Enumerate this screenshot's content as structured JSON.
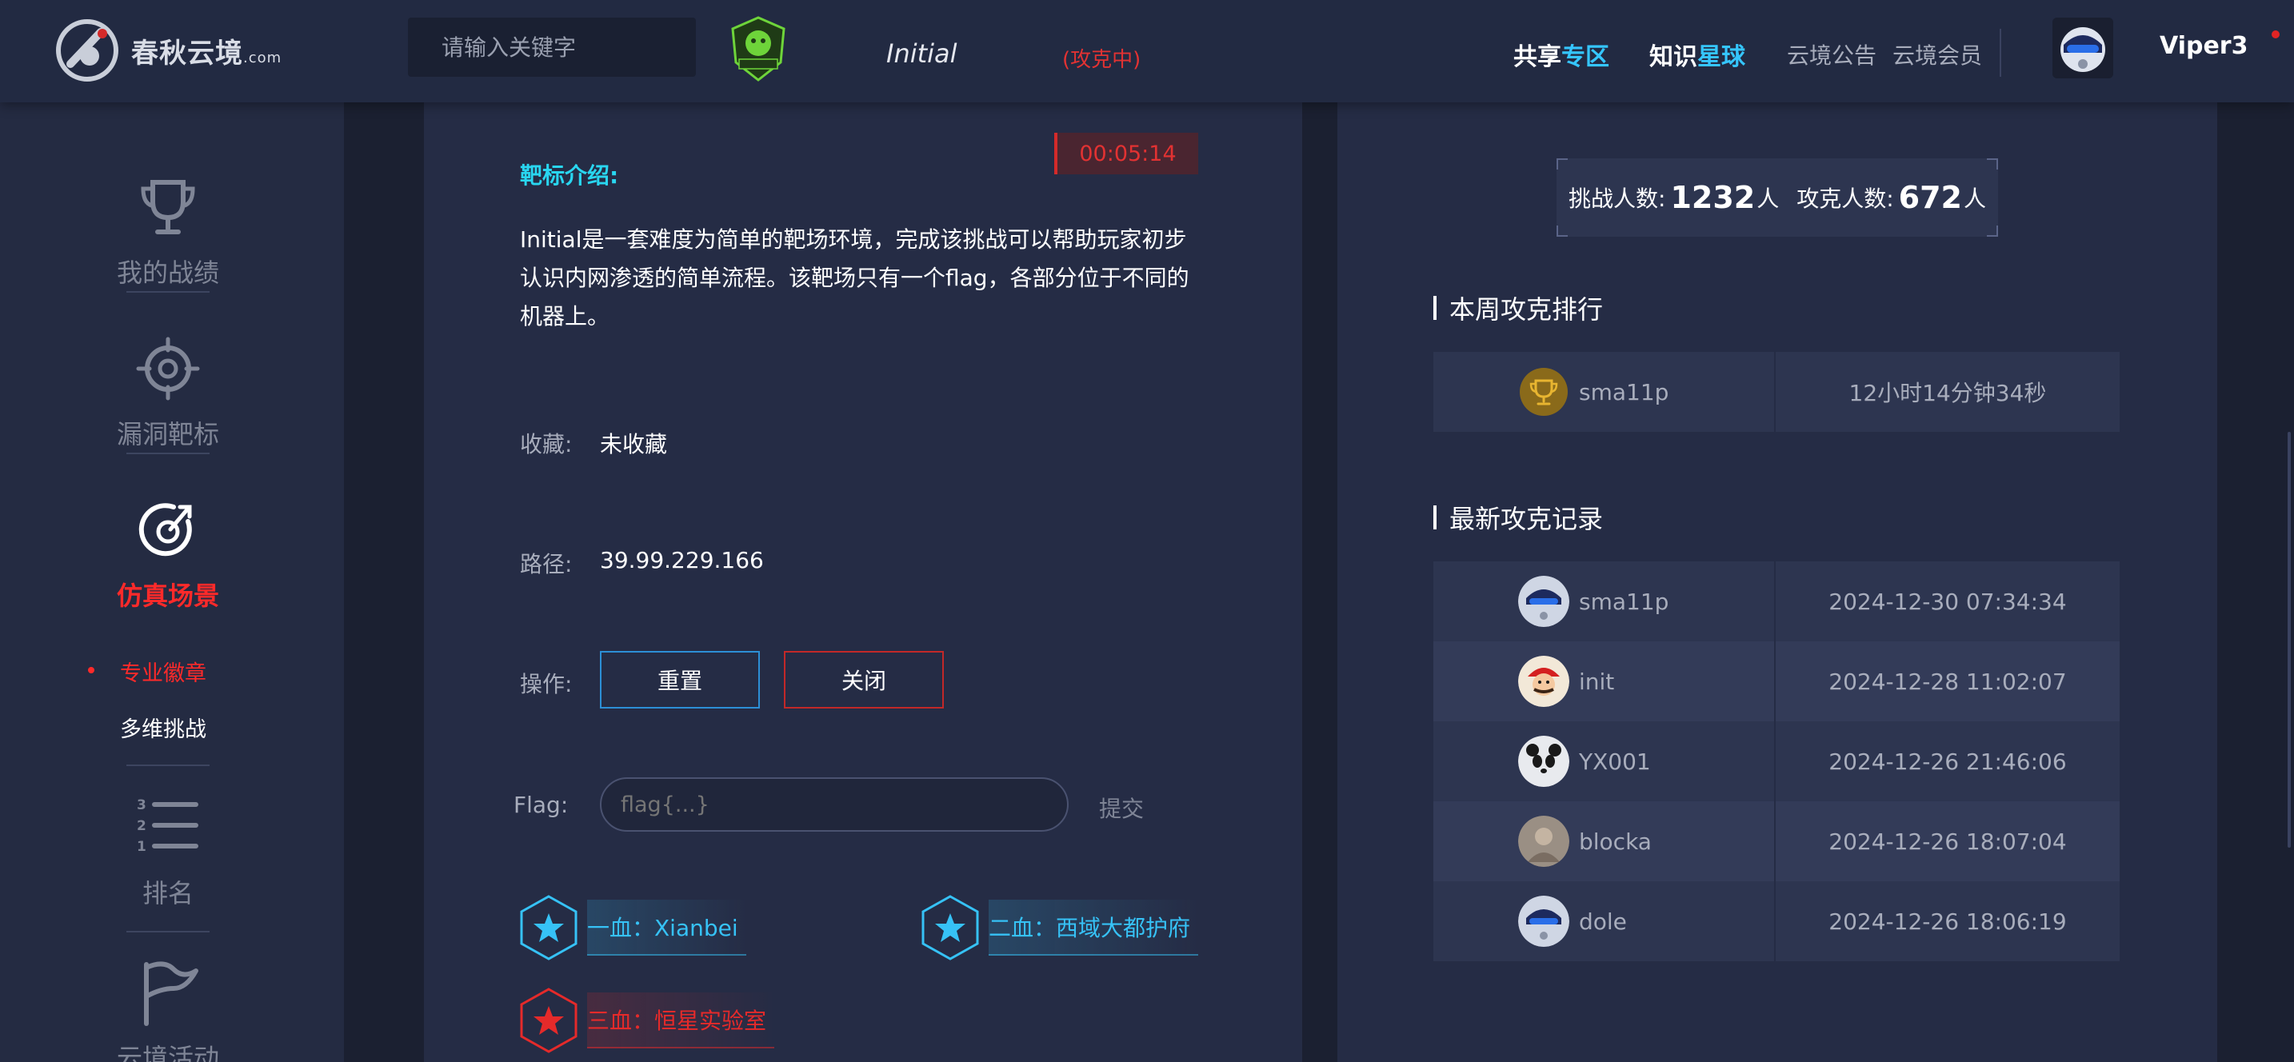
{
  "header": {
    "logo_text": "春秋云境",
    "logo_suffix": ".com",
    "search_placeholder": "请输入关键字",
    "target_name": "Initial",
    "target_status": "(攻克中)",
    "nav_share_a": "共享",
    "nav_share_b": "专区",
    "nav_planet_a": "知识",
    "nav_planet_b": "星球",
    "nav_notice": "云境公告",
    "nav_member": "云境会员",
    "username": "Viper3"
  },
  "sidebar": {
    "items": [
      {
        "label": "我的战绩",
        "icon": "trophy-icon"
      },
      {
        "label": "漏洞靶标",
        "icon": "crosshair-icon"
      },
      {
        "label": "仿真场景",
        "icon": "refresh-target-icon"
      },
      {
        "label": "排名",
        "icon": "ranking-list-icon"
      },
      {
        "label": "云境活动",
        "icon": "flag-icon"
      }
    ],
    "sub_items": [
      {
        "label": "专业徽章"
      },
      {
        "label": "多维挑战"
      }
    ]
  },
  "main": {
    "timer": "00:05:14",
    "intro_title": "靶标介绍:",
    "description": "Initial是一套难度为简单的靶场环境，完成该挑战可以帮助玩家初步认识内网渗透的简单流程。该靶场只有一个flag，各部分位于不同的机器上。",
    "favorite_label": "收藏:",
    "favorite_value": "未收藏",
    "path_label": "路径:",
    "path_value": "39.99.229.166",
    "action_label": "操作:",
    "reset_button": "重置",
    "close_button": "关闭",
    "flag_label": "Flag:",
    "flag_placeholder": "flag{...}",
    "submit_button": "提交",
    "bloods": [
      {
        "text": "一血：Xianbei",
        "color": "#36c2f6"
      },
      {
        "text": "二血：西域大都护府",
        "color": "#36c2f6"
      },
      {
        "text": "三血：恒星实验室",
        "color": "#e52a2a"
      }
    ]
  },
  "side_stats": {
    "challengers_label": "挑战人数:",
    "challengers_value": "1232",
    "unit1": "人",
    "solvers_label": "攻克人数:",
    "solvers_value": "672",
    "unit2": "人"
  },
  "weekly_rank": {
    "title": "本周攻克排行",
    "rows": [
      {
        "name": "sma11p",
        "time": "12小时14分钟34秒"
      }
    ]
  },
  "latest_records": {
    "title": "最新攻克记录",
    "rows": [
      {
        "name": "sma11p",
        "time": "2024-12-30 07:34:34"
      },
      {
        "name": "init",
        "time": "2024-12-28 11:02:07"
      },
      {
        "name": "YX001",
        "time": "2024-12-26 21:46:06"
      },
      {
        "name": "blocka",
        "time": "2024-12-26 18:07:04"
      },
      {
        "name": "dole",
        "time": "2024-12-26 18:06:19"
      }
    ]
  },
  "colors": {
    "accent_cyan": "#29d6f0",
    "accent_blue": "#35c6ff",
    "danger_red": "#e23232",
    "bg_dark": "#1d2234",
    "panel": "#252c45"
  }
}
